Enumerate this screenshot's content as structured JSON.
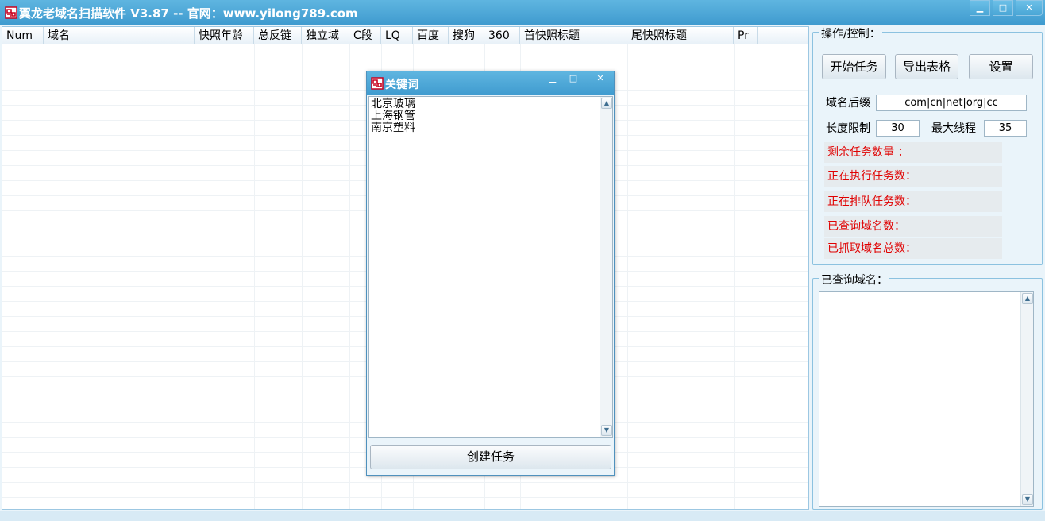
{
  "window": {
    "title": "翼龙老域名扫描软件 V3.87 -- 官网：www.yilong789.com",
    "min_glyph": "▁",
    "max_glyph": "□",
    "close_glyph": "✕"
  },
  "list": {
    "columns": [
      "Num",
      "域名",
      "快照年龄",
      "总反链",
      "独立域",
      "C段",
      "LQ",
      "百度",
      "搜狗",
      "360",
      "首快照标题",
      "尾快照标题",
      "Pr"
    ]
  },
  "control_group": {
    "legend": "操作/控制：",
    "start_button": "开始任务",
    "export_button": "导出表格",
    "settings_button": "设置",
    "suffix_label": "域名后缀",
    "suffix_value": "com|cn|net|org|cc",
    "length_label": "长度限制",
    "length_value": "30",
    "threads_label": "最大线程",
    "threads_value": "35",
    "stats": [
      "剩余任务数量 ：",
      "正在执行任务数：",
      "正在排队任务数：",
      "已查询域名数：",
      "已抓取域名总数："
    ]
  },
  "queried_group": {
    "legend": "已查询域名："
  },
  "dialog": {
    "title": "关键词",
    "keywords": [
      "北京玻璃",
      "上海钢管",
      "南京塑料"
    ],
    "create_button": "创建任务"
  },
  "colors": {
    "titlebar": "#4aa6d6",
    "stat_text": "#e00000",
    "panel_bg": "#eaf4fa"
  }
}
